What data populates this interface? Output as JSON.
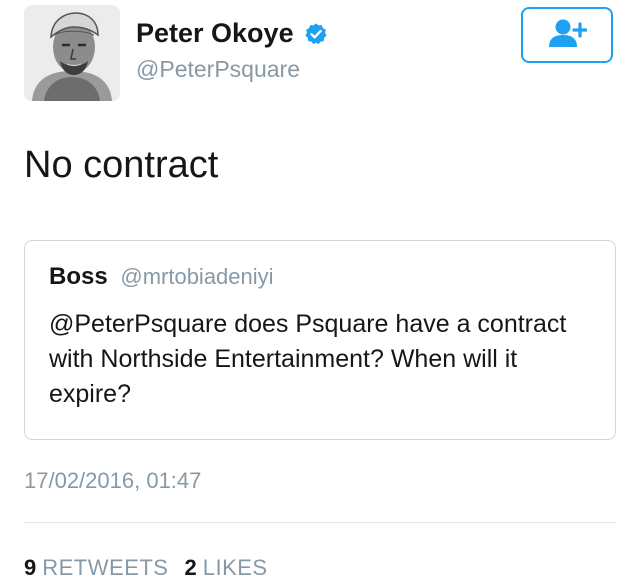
{
  "author": {
    "name": "Peter Okoye",
    "handle": "@PeterPsquare",
    "verified": true,
    "avatar": "grayscale-portrait-sketch"
  },
  "follow_button": {
    "icon": "add-user-icon",
    "color": "#1da1f2"
  },
  "tweet": {
    "text": "No contract",
    "timestamp": "17/02/2016, 01:47"
  },
  "quoted_tweet": {
    "name": "Boss",
    "handle": "@mrtobiadeniyi",
    "text": "@PeterPsquare does Psquare have a contract with Northside Entertainment? When will it expire?"
  },
  "stats": {
    "retweets_count": "9",
    "retweets_label": "RETWEETS",
    "likes_count": "2",
    "likes_label": "LIKES"
  },
  "colors": {
    "accent": "#1da1f2",
    "text": "#14171a",
    "muted": "#8899a6",
    "border": "#ccd6dd"
  }
}
